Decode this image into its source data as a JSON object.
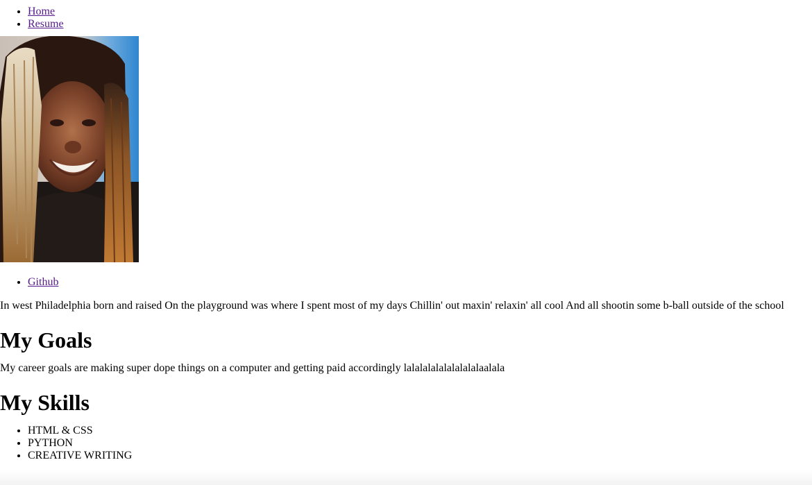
{
  "nav": {
    "items": [
      {
        "label": "Home"
      },
      {
        "label": "Resume"
      }
    ]
  },
  "profile": {
    "photo_icon": "profile-photo",
    "links": [
      {
        "label": "Github"
      }
    ]
  },
  "bio": {
    "text": "In west Philadelphia born and raised On the playground was where I spent most of my days Chillin' out maxin' relaxin' all cool And all shootin some b-ball outside of the school"
  },
  "goals": {
    "heading": "My Goals",
    "text": "My career goals are making super dope things on a computer and getting paid accordingly lalalalalalalalalalaalala"
  },
  "skills": {
    "heading": "My Skills",
    "items": [
      {
        "label": "HTML & CSS"
      },
      {
        "label": "PYTHON"
      },
      {
        "label": "CREATIVE WRITING"
      }
    ]
  },
  "colors": {
    "link": "#551a8b",
    "text": "#000000",
    "background": "#ffffff"
  }
}
